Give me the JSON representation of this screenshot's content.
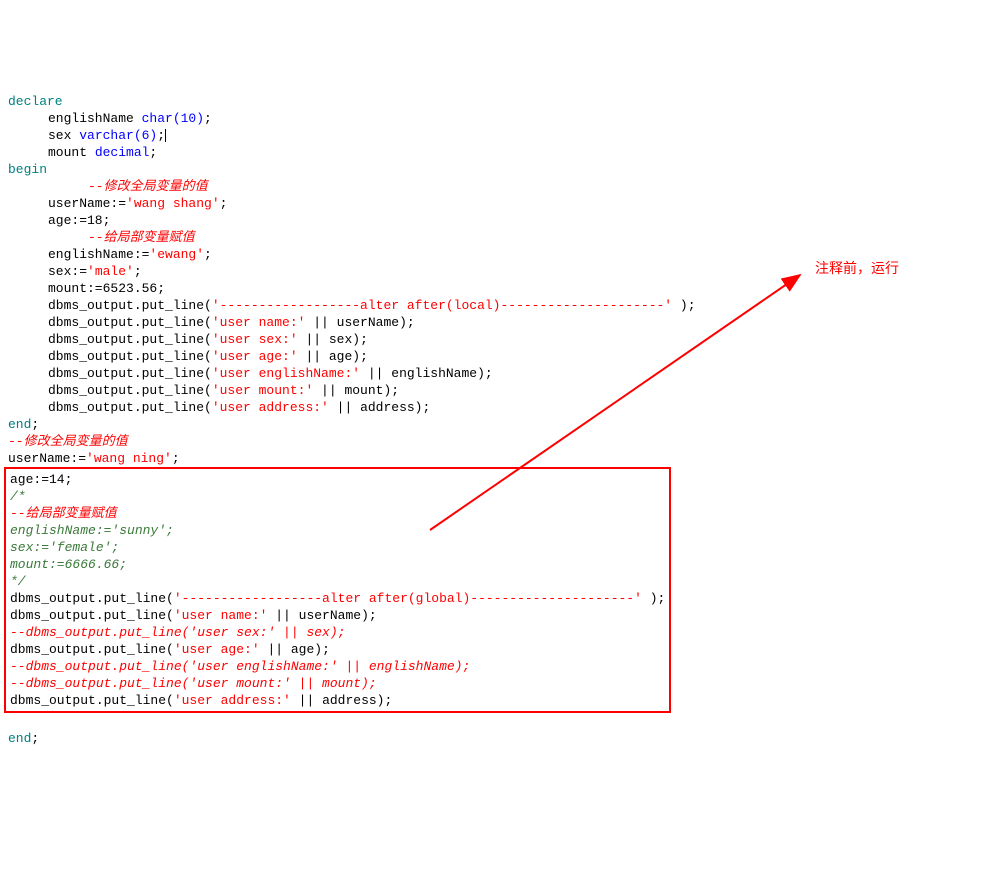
{
  "code": {
    "l1_kw_declare": "declare",
    "l2_ident": "englishName ",
    "l2_type": "char(10)",
    "l2_semi": ";",
    "l3_ident": "sex ",
    "l3_type": "varchar(6)",
    "l3_semi": ";",
    "l4_ident": "mount ",
    "l4_type": "decimal",
    "l4_semi": ";",
    "l5_kw_begin": "begin",
    "l6_comment": "--修改全局变量的值",
    "l7_assign": "userName:=",
    "l7_str": "'wang shang'",
    "l7_semi": ";",
    "l8_assign": "age:=18;",
    "l9_comment": "--给局部变量赋值",
    "l10_assign": "englishName:=",
    "l10_str": "'ewang'",
    "l10_semi": ";",
    "l11_assign": "sex:=",
    "l11_str": "'male'",
    "l11_semi": ";",
    "l12_assign": "mount:=6523.56;",
    "l13a": "dbms_output.put_line(",
    "l13b": "'------------------alter after(local)---------------------'",
    "l13c": " );",
    "l14a": "dbms_output.put_line(",
    "l14b": "'user name:'",
    "l14c": " || userName);",
    "l15a": "dbms_output.put_line(",
    "l15b": "'user sex:'",
    "l15c": " || sex);",
    "l16a": "dbms_output.put_line(",
    "l16b": "'user age:'",
    "l16c": " || age);",
    "l17a": "dbms_output.put_line(",
    "l17b": "'user englishName:'",
    "l17c": " || englishName);",
    "l18a": "dbms_output.put_line(",
    "l18b": "'user mount:'",
    "l18c": " || mount);",
    "l19a": "dbms_output.put_line(",
    "l19b": "'user address:'",
    "l19c": " || address);",
    "l20_kw_end": "end",
    "l20_semi": ";",
    "l21_comment": "--修改全局变量的值",
    "l22_assign": "userName:=",
    "l22_str": "'wang ning'",
    "l22_semi": ";",
    "box_l1": "age:=14;",
    "box_l2": "/*",
    "box_l3_comment": "--给局部变量赋值",
    "box_l4": "englishName:='sunny';",
    "box_l5": "sex:='female';",
    "box_l6": "mount:=6666.66;",
    "box_l7": "*/",
    "box_l8a": "dbms_output.put_line(",
    "box_l8b": "'------------------alter after(global)---------------------'",
    "box_l8c": " );",
    "box_l9a": "dbms_output.put_line(",
    "box_l9b": "'user name:'",
    "box_l9c": " || userName);",
    "box_l10": "--dbms_output.put_line('user sex:' || sex);",
    "box_l11a": "dbms_output.put_line(",
    "box_l11b": "'user age:'",
    "box_l11c": " || age);",
    "box_l12": "--dbms_output.put_line('user englishName:' || englishName);",
    "box_l13": "--dbms_output.put_line('user mount:' || mount);",
    "box_l14a": "dbms_output.put_line(",
    "box_l14b": "'user address:'",
    "box_l14c": " || address);",
    "l_last_kw_end": "end",
    "l_last_semi": ";"
  },
  "annotation_text": "注释前，运行"
}
